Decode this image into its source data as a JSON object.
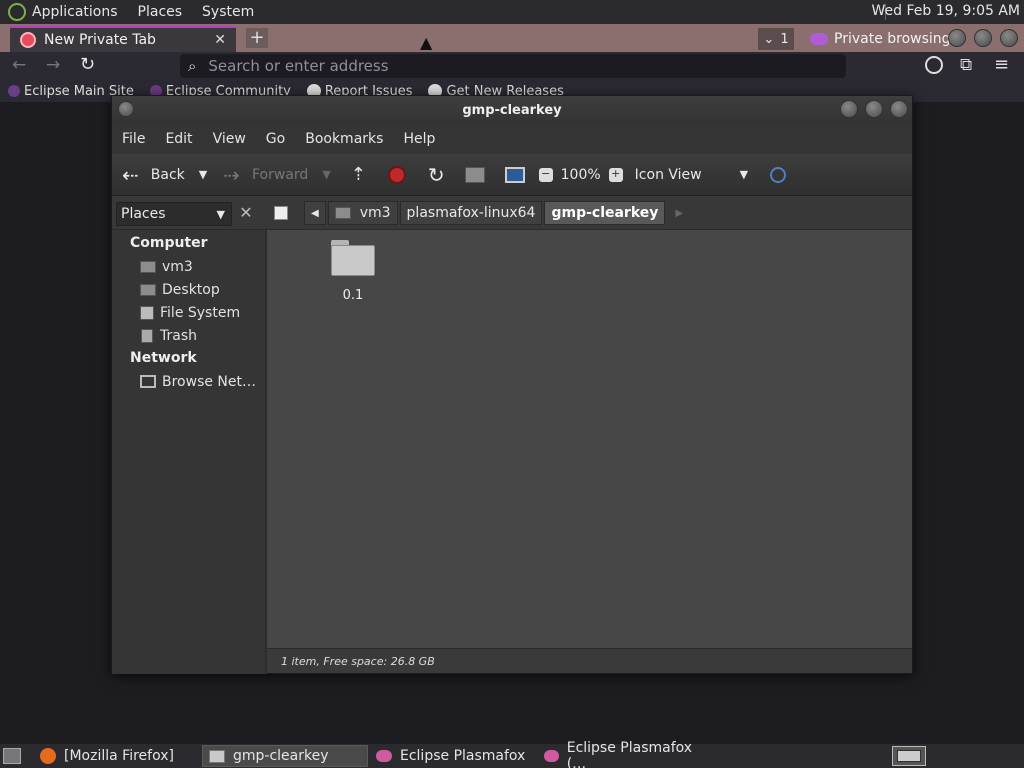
{
  "top_panel": {
    "menus": [
      "Applications",
      "Places",
      "System"
    ],
    "clock": "Wed Feb 19,  9:05 AM"
  },
  "firefox": {
    "tab": {
      "title": "New Private Tab"
    },
    "tab_count": "1",
    "private_label": "Private browsing",
    "url_placeholder": "Search or enter address",
    "bookmarks": [
      "Eclipse Main Site",
      "Eclipse Community",
      "Report Issues",
      "Get New Releases"
    ]
  },
  "caja": {
    "title": "gmp-clearkey",
    "menu": [
      "File",
      "Edit",
      "View",
      "Go",
      "Bookmarks",
      "Help"
    ],
    "toolbar": {
      "back": "Back",
      "forward": "Forward",
      "zoom": "100%",
      "view_mode": "Icon View"
    },
    "sidebar_combo": "Places",
    "breadcrumbs": [
      "vm3",
      "plasmafox-linux64",
      "gmp-clearkey"
    ],
    "sidebar": {
      "computer_header": "Computer",
      "computer_items": [
        "vm3",
        "Desktop",
        "File System",
        "Trash"
      ],
      "network_header": "Network",
      "network_items": [
        "Browse Net…"
      ]
    },
    "files": [
      {
        "name": "0.1"
      }
    ],
    "status": "1 item, Free space: 26.8 GB"
  },
  "taskbar": {
    "tasks": [
      "[Mozilla Firefox]",
      "gmp-clearkey",
      "Eclipse Plasmafox",
      "Eclipse Plasmafox (…"
    ]
  },
  "colors": {
    "accent": "#b83cbd",
    "tab_bar": "#8a6f6e",
    "folder": "#c9c9c9"
  }
}
